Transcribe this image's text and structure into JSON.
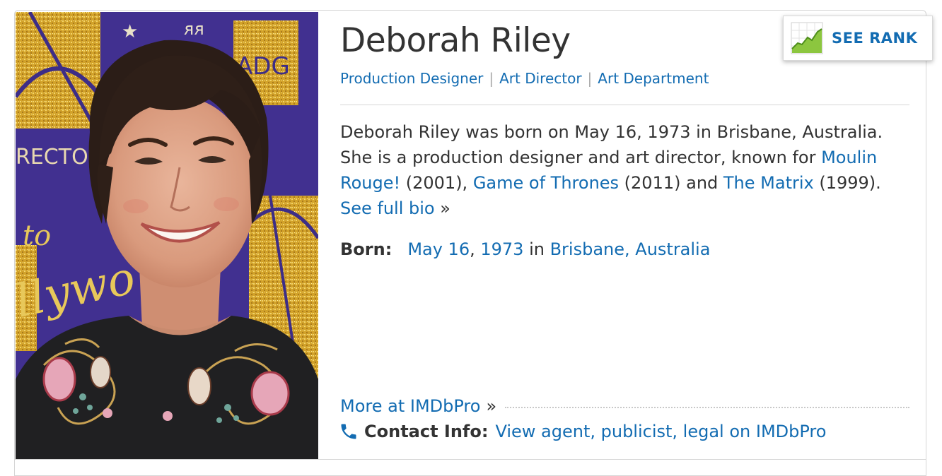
{
  "person": {
    "name": "Deborah Riley",
    "professions": [
      "Production Designer",
      "Art Director",
      "Art Department"
    ],
    "separator": "|"
  },
  "bio": {
    "part1": "Deborah Riley was born on May 16, 1973 in Brisbane, Australia. She is a production designer and art director, known for ",
    "credit1_title": "Moulin Rouge!",
    "credit1_year": " (2001), ",
    "credit2_title": "Game of Thrones",
    "credit2_year": " (2011) and ",
    "credit3_title": "The Matrix",
    "credit3_year": " (1999). ",
    "see_full_bio": "See full bio",
    "raquo": "»"
  },
  "born": {
    "label": "Born:",
    "month_day": "May 16",
    "comma": ", ",
    "year": "1973",
    "in": " in ",
    "place": "Brisbane, Australia"
  },
  "imdbpro": {
    "more_label": "More at IMDbPro",
    "raquo": "»",
    "contact_label": "Contact Info:",
    "contact_link": "View agent, publicist, legal on IMDbPro",
    "phone_icon": "phone-icon"
  },
  "rank_button": {
    "label": "SEE RANK",
    "icon": "rank-chart-icon"
  },
  "photo": {
    "icon": "person-photo",
    "backdrop_text": "ADG",
    "accent": "#d4a62a",
    "background": "#3e2e86"
  },
  "colors": {
    "link": "#136cb2",
    "text": "#333333",
    "border": "#d6d6d6"
  }
}
